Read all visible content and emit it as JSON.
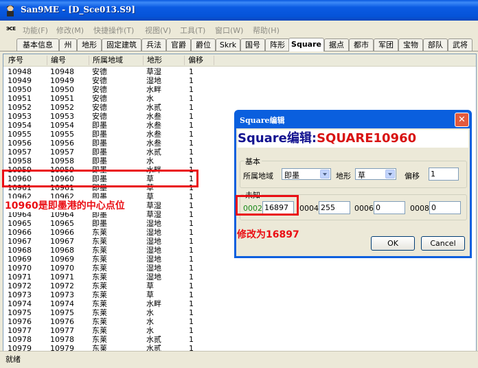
{
  "window": {
    "title": "San9ME - [D_Sce013.S9]"
  },
  "menu": {
    "sys_icon": "ЭСЕ",
    "items": [
      "功能(F)",
      "修改(M)",
      "快捷操作(T)",
      "视图(V)",
      "工具(T)",
      "窗口(W)",
      "帮助(H)"
    ]
  },
  "tabs": [
    "基本信息",
    "州",
    "地形",
    "固定建筑",
    "兵法",
    "官爵",
    "爵位",
    "Skrk",
    "国号",
    "阵形",
    "Square",
    "据点",
    "都市",
    "军团",
    "宝物",
    "部队",
    "武将"
  ],
  "active_tab": "Square",
  "list": {
    "columns": [
      "序号",
      "编号",
      "所属地域",
      "地形",
      "偏移"
    ],
    "rows": [
      [
        "10948",
        "10948",
        "安德",
        "草湿",
        "1"
      ],
      [
        "10949",
        "10949",
        "安德",
        "湿地",
        "1"
      ],
      [
        "10950",
        "10950",
        "安德",
        "水畔",
        "1"
      ],
      [
        "10951",
        "10951",
        "安德",
        "水",
        "1"
      ],
      [
        "10952",
        "10952",
        "安德",
        "水贰",
        "1"
      ],
      [
        "10953",
        "10953",
        "安德",
        "水叁",
        "1"
      ],
      [
        "10954",
        "10954",
        "即墨",
        "水叁",
        "1"
      ],
      [
        "10955",
        "10955",
        "即墨",
        "水叁",
        "1"
      ],
      [
        "10956",
        "10956",
        "即墨",
        "水叁",
        "1"
      ],
      [
        "10957",
        "10957",
        "即墨",
        "水贰",
        "1"
      ],
      [
        "10958",
        "10958",
        "即墨",
        "水",
        "1"
      ],
      [
        "10959",
        "10959",
        "即墨",
        "水畔",
        "1"
      ],
      [
        "10960",
        "10960",
        "即墨",
        "草",
        "1"
      ],
      [
        "10961",
        "10961",
        "即墨",
        "草",
        "1"
      ],
      [
        "10962",
        "10962",
        "即墨",
        "草",
        "1"
      ],
      [
        "10963",
        "10963",
        "即墨",
        "草湿",
        "1"
      ],
      [
        "10964",
        "10964",
        "即墨",
        "草湿",
        "1"
      ],
      [
        "10965",
        "10965",
        "即墨",
        "湿地",
        "1"
      ],
      [
        "10966",
        "10966",
        "东莱",
        "湿地",
        "1"
      ],
      [
        "10967",
        "10967",
        "东莱",
        "湿地",
        "1"
      ],
      [
        "10968",
        "10968",
        "东莱",
        "湿地",
        "1"
      ],
      [
        "10969",
        "10969",
        "东莱",
        "湿地",
        "1"
      ],
      [
        "10970",
        "10970",
        "东莱",
        "湿地",
        "1"
      ],
      [
        "10971",
        "10971",
        "东莱",
        "湿地",
        "1"
      ],
      [
        "10972",
        "10972",
        "东莱",
        "草",
        "1"
      ],
      [
        "10973",
        "10973",
        "东莱",
        "草",
        "1"
      ],
      [
        "10974",
        "10974",
        "东莱",
        "水畔",
        "1"
      ],
      [
        "10975",
        "10975",
        "东莱",
        "水",
        "1"
      ],
      [
        "10976",
        "10976",
        "东莱",
        "水",
        "1"
      ],
      [
        "10977",
        "10977",
        "东莱",
        "水",
        "1"
      ],
      [
        "10978",
        "10978",
        "东莱",
        "水贰",
        "1"
      ],
      [
        "10979",
        "10979",
        "东莱",
        "水贰",
        "1"
      ]
    ]
  },
  "annotations": {
    "left_note": "10960是即墨港的中心点位",
    "dialog_note": "修改为16897",
    "color": "#ea0e14"
  },
  "dialog": {
    "title": "Square编辑",
    "heading_prefix": "Square编辑:",
    "heading_name": "SQUARE10960",
    "basic_group": "基本",
    "region_label": "所属地域",
    "region_value": "即墨",
    "terrain_label": "地形",
    "terrain_value": "草",
    "offset_label": "偏移",
    "offset_value": "1",
    "unknown_group": "未知",
    "f0002_label": "0002",
    "f0002_value": "16897",
    "f0004_label": "0004",
    "f0004_value": "255",
    "f0006_label": "0006",
    "f0006_value": "0",
    "f0008_label": "0008",
    "f0008_value": "0",
    "ok": "OK",
    "cancel": "Cancel"
  },
  "status": {
    "text": "就绪"
  }
}
